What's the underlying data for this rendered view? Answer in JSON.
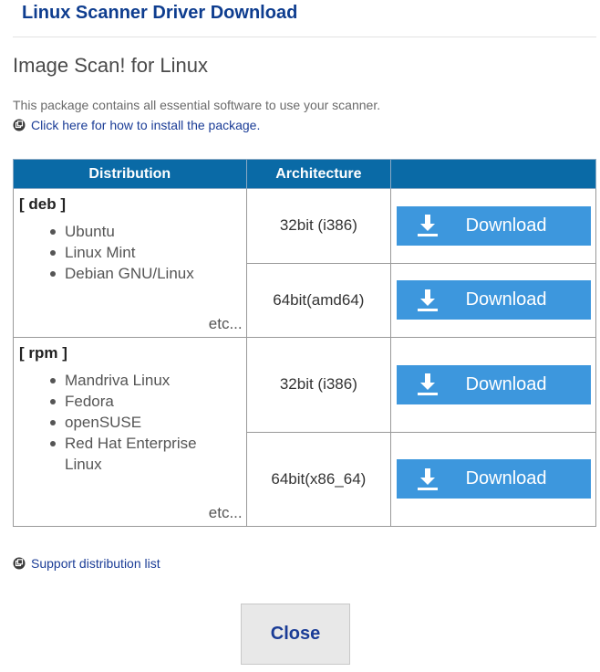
{
  "header": {
    "title": "Linux Scanner Driver Download"
  },
  "page": {
    "title": "Image Scan! for Linux",
    "description": "This package contains all essential software to use your scanner.",
    "install_link": "Click here for how to install the package.",
    "support_link": "Support distribution list"
  },
  "table": {
    "headers": {
      "distribution": "Distribution",
      "architecture": "Architecture",
      "download": ""
    },
    "groups": [
      {
        "label": "[ deb ]",
        "distros": [
          "Ubuntu",
          "Linux Mint",
          "Debian GNU/Linux"
        ],
        "etc": "etc...",
        "rows": [
          {
            "arch": "32bit (i386)",
            "button": "Download"
          },
          {
            "arch": "64bit(amd64)",
            "button": "Download"
          }
        ]
      },
      {
        "label": "[ rpm ]",
        "distros": [
          "Mandriva Linux",
          "Fedora",
          "openSUSE",
          "Red Hat Enterprise Linux"
        ],
        "etc": "etc...",
        "rows": [
          {
            "arch": "32bit (i386)",
            "button": "Download"
          },
          {
            "arch": "64bit(x86_64)",
            "button": "Download"
          }
        ]
      }
    ]
  },
  "close_button": "Close",
  "colors": {
    "header_text": "#0e3d8f",
    "table_header_bg": "#0a6aa6",
    "download_button_bg": "#3d97dd",
    "link": "#1a3c96"
  },
  "icons": {
    "link_bullet": "circle-arrow-icon",
    "download": "download-arrow-icon"
  }
}
